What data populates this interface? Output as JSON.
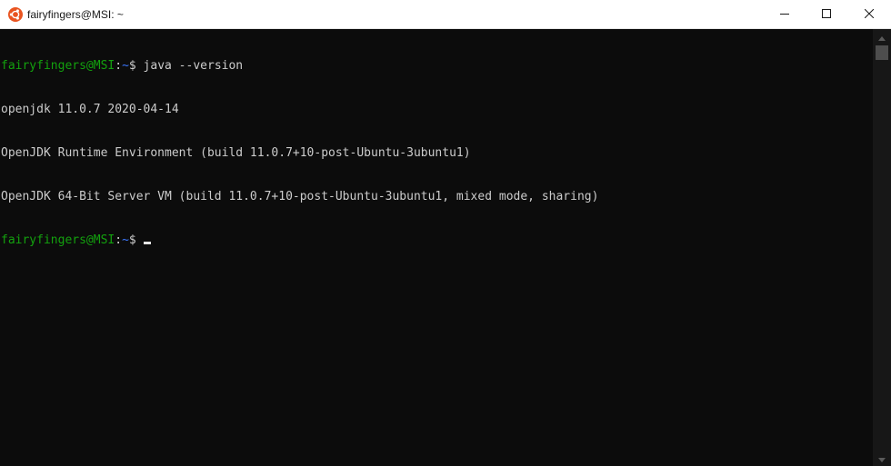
{
  "window": {
    "title": "fairyfingers@MSI: ~",
    "app_icon": "ubuntu-icon",
    "accent_color": "#e95420"
  },
  "controls": {
    "minimize_icon": "minimize-icon",
    "maximize_icon": "maximize-icon",
    "close_icon": "close-icon"
  },
  "terminal": {
    "lines": [
      {
        "type": "prompt",
        "user": "fairyfingers@MSI",
        "sep": ":",
        "path": "~",
        "symbol": "$ ",
        "command": "java --version"
      },
      {
        "type": "output",
        "text": "openjdk 11.0.7 2020-04-14"
      },
      {
        "type": "output",
        "text": "OpenJDK Runtime Environment (build 11.0.7+10-post-Ubuntu-3ubuntu1)"
      },
      {
        "type": "output",
        "text": "OpenJDK 64-Bit Server VM (build 11.0.7+10-post-Ubuntu-3ubuntu1, mixed mode, sharing)"
      },
      {
        "type": "prompt",
        "user": "fairyfingers@MSI",
        "sep": ":",
        "path": "~",
        "symbol": "$ ",
        "command": ""
      }
    ],
    "colors": {
      "background": "#0c0c0c",
      "foreground": "#cccccc",
      "prompt_user": "#13a10e",
      "prompt_path": "#3b78ff"
    }
  }
}
